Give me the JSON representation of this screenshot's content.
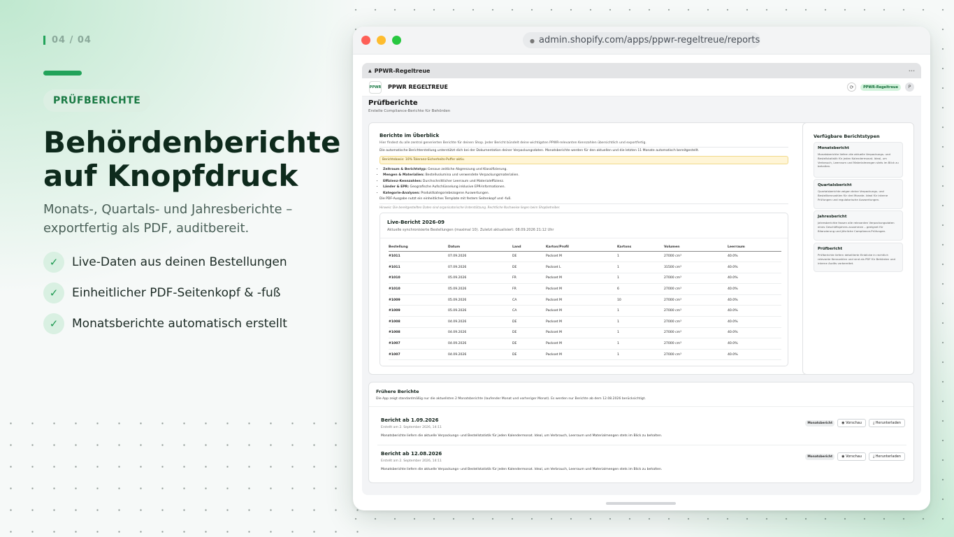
{
  "slide": {
    "counter": "04 / 04",
    "tag": "PRÜFBERICHTE",
    "headline_line1": "Behördenberichte",
    "headline_line2": "auf Knopfdruck",
    "subline": "Monats-, Quartals- und Jahresberichte – exportfertig als PDF, auditbereit.",
    "features": [
      "Live-Daten aus deinen Bestellungen",
      "Einheitlicher PDF-Seitenkopf & -fuß",
      "Monatsberichte automatisch erstellt"
    ],
    "check_glyph": "✓"
  },
  "browser": {
    "url": "admin.shopify.com/apps/ppwr-regeltreue/reports"
  },
  "app": {
    "topbar_title": "PPWR-Regeltreue",
    "topbar_menu": "···",
    "logo_text": "PPWR",
    "name": "PPWR REGELTREUE",
    "status_badge": "PPWR-Regeltreue",
    "avatar": "P",
    "page_title": "Prüfberichte",
    "page_subtitle": "Erstelle Compliance-Berichte für Behörden"
  },
  "overview": {
    "title": "Berichte im Überblick",
    "description": "Hier findest du alle zentral generierten Berichte für deinen Shop. Jeder Bericht bündelt deine wichtigsten PPWR-relevanten Kennzahlen übersichtlich und exportfertig.",
    "auto_text": "Die automatische Berichterstellung unterstützt dich bei der Dokumentation deiner Verpackungsdaten. Monatsberichte werden für den aktuellen und die letzten 11 Monate automatisch bereitgestellt.",
    "hint": "Berichtsbasis: 10% Toleranz-Sicherheits-Puffer aktiv.",
    "bullets": [
      {
        "label": "Zeitraum & Berichtstyp:",
        "text": " Genaue zeitliche Abgrenzung und Klassifizierung."
      },
      {
        "label": "Mengen & Materialien:",
        "text": " Bestellvolumina und verwendete Verpackungsmaterialien."
      },
      {
        "label": "Effizienz-Kennzahlen:",
        "text": " Durchschnittlicher Leerraum und Materialeffizienz."
      },
      {
        "label": "Länder & EPR:",
        "text": " Geografische Aufschlüsselung inklusive EPR-Informationen."
      },
      {
        "label": "Kategorie-Analysen:",
        "text": " Produktkategoriebezogene Auswertungen."
      }
    ],
    "pdf_text": "Die PDF-Ausgabe nutzt ein einheitliches Template mit festem Seitenkopf und -fuß.",
    "note": "Hinweis: Die bereitgestellten Daten sind organisatorische Unterstützung. Rechtliche Nachweise liegen beim Shopbetreiber."
  },
  "live_report": {
    "title": "Live-Bericht 2026-09",
    "subtitle": "Aktuelle synchronisierte Bestellungen (maximal 10). Zuletzt aktualisiert: 08.09.2026 21:12 Uhr",
    "columns": [
      "Bestellung",
      "Datum",
      "Land",
      "Karton/Profil",
      "Kartons",
      "Volumen",
      "Leerraum"
    ],
    "rows": [
      [
        "#1011",
        "07.09.2026",
        "DE",
        "Packset M",
        "1",
        "27000 cm³",
        "40.0%"
      ],
      [
        "#1011",
        "07.09.2026",
        "DE",
        "Packset L",
        "1",
        "31500 cm³",
        "40.0%"
      ],
      [
        "#1010",
        "05.09.2026",
        "FR",
        "Packset M",
        "1",
        "27000 cm³",
        "40.0%"
      ],
      [
        "#1010",
        "05.09.2026",
        "FR",
        "Packset M",
        "6",
        "27000 cm³",
        "40.0%"
      ],
      [
        "#1009",
        "05.09.2026",
        "CA",
        "Packset M",
        "10",
        "27000 cm³",
        "40.0%"
      ],
      [
        "#1009",
        "05.09.2026",
        "CA",
        "Packset M",
        "1",
        "27000 cm³",
        "40.0%"
      ],
      [
        "#1008",
        "04.09.2026",
        "DE",
        "Packset M",
        "1",
        "27000 cm³",
        "40.0%"
      ],
      [
        "#1008",
        "04.09.2026",
        "DE",
        "Packset M",
        "1",
        "27000 cm³",
        "40.0%"
      ],
      [
        "#1007",
        "04.09.2026",
        "DE",
        "Packset M",
        "1",
        "27000 cm³",
        "40.0%"
      ],
      [
        "#1007",
        "04.09.2026",
        "DE",
        "Packset M",
        "1",
        "27000 cm³",
        "40.0%"
      ]
    ]
  },
  "report_types": {
    "title": "Verfügbare Berichtstypen",
    "items": [
      {
        "name": "Monatsbericht",
        "text": "Monatsberichte liefern die aktuelle Verpackungs- und Bestellstatistik für jeden Kalendermonat. Ideal, um Verbrauch, Leerraum und Materialmengen stets im Blick zu behalten."
      },
      {
        "name": "Quartalsbericht",
        "text": "Quartalsberichte zeigen deine Verpackungs- und Bestellkennzahlen für drei Monate. Ideal für interne Prüfungen und regulatorische Auswertungen."
      },
      {
        "name": "Jahresbericht",
        "text": "Jahresberichte fassen alle relevanten Verpackungsdaten eines Geschäftsjahres zusammen – geeignet für Bilanzierung und jährliche Compliance-Prüfungen."
      },
      {
        "name": "Prüfbericht",
        "text": "Prüfberichte liefern detaillierte Einblicke in rechtlich relevante Kennzahlen und sind als PDF für Behörden und interne Audits vorbereitet."
      }
    ]
  },
  "earlier_reports": {
    "title": "Frühere Berichte",
    "description": "Die App zeigt standardmäßig nur die aktuellsten 2 Monatsberichte (laufender Monat und vorheriger Monat). Es werden nur Berichte ab dem 12.08.2026 berücksichtigt.",
    "items": [
      {
        "title": "Bericht ab 1.09.2026",
        "created": "Erstellt am 2. September 2026, 14:11",
        "desc": "Monatsberichte liefern die aktuelle Verpackungs- und Bestellstatistik für jeden Kalendermonat. Ideal, um Verbrauch, Leerraum und Materialmengen stets im Blick zu behalten.",
        "badge": "Monatsbericht",
        "preview": "Vorschau",
        "download": "Herunterladen"
      },
      {
        "title": "Bericht ab 12.08.2026",
        "created": "Erstellt am 2. September 2026, 14:11",
        "desc": "Monatsberichte liefern die aktuelle Verpackungs- und Bestellstatistik für jeden Kalendermonat. Ideal, um Verbrauch, Leerraum und Materialmengen stets im Blick zu behalten.",
        "badge": "Monatsbericht",
        "preview": "Vorschau",
        "download": "Herunterladen"
      }
    ]
  },
  "icons": {
    "lock": "lock-icon",
    "refresh": "refresh-icon",
    "eye": "eye-icon",
    "download": "download-icon"
  },
  "colors": {
    "accent": "#22a35a",
    "accent_dark": "#1a7a44",
    "headline": "#0e2a1c"
  }
}
